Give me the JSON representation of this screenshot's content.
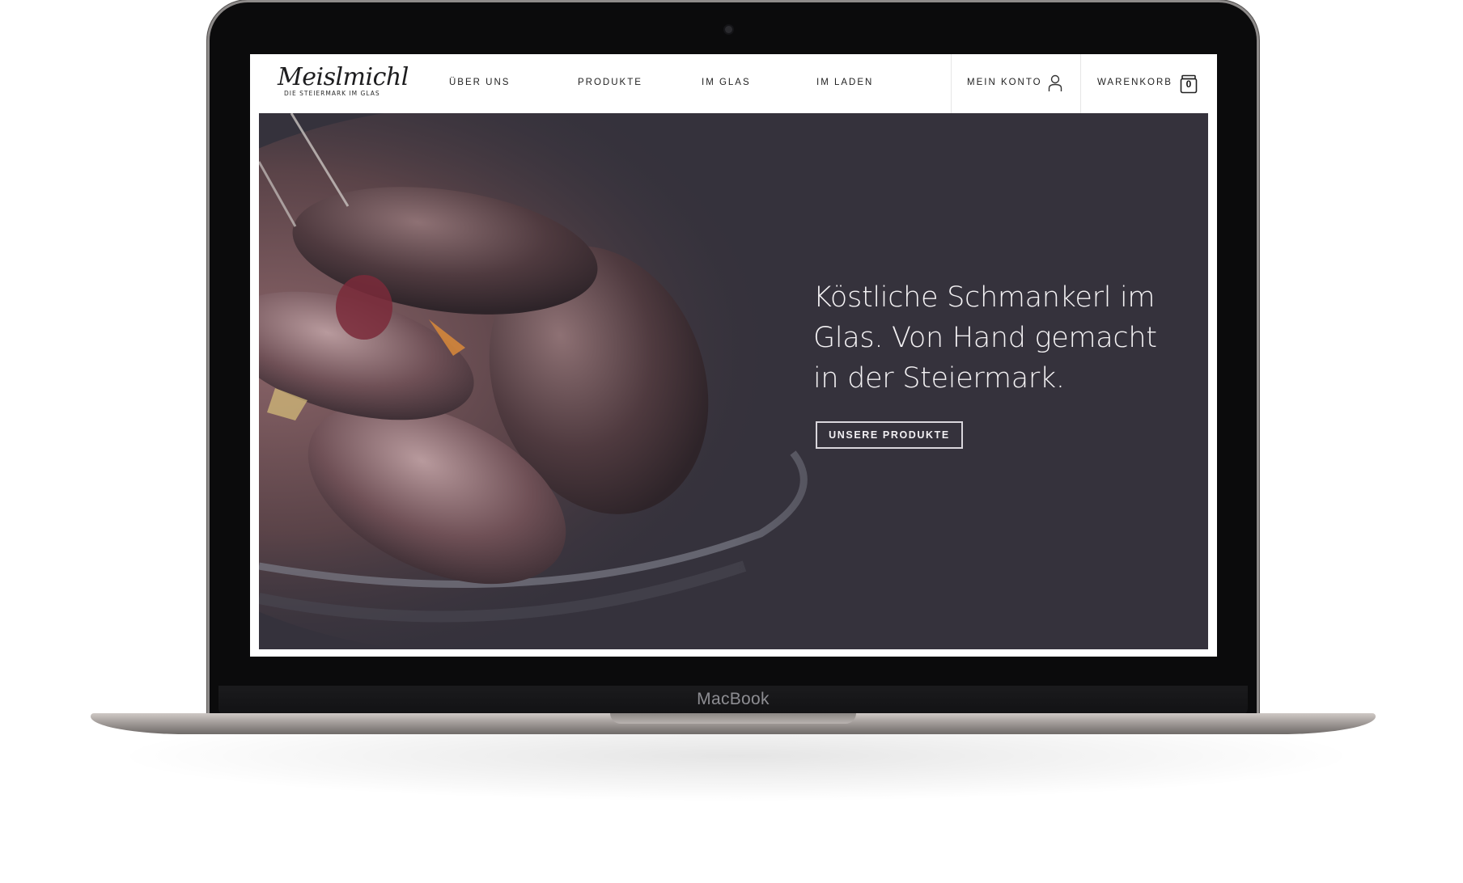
{
  "device": {
    "label": "MacBook"
  },
  "header": {
    "logo_text": "Meislmichl",
    "logo_subtitle": "DIE STEIERMARK IM GLAS",
    "nav": [
      {
        "label": "ÜBER UNS"
      },
      {
        "label": "PRODUKTE"
      },
      {
        "label": "IM GLAS"
      },
      {
        "label": "IM LADEN"
      }
    ],
    "account_label": "MEIN KONTO",
    "cart_label": "WARENKORB",
    "cart_count": "0"
  },
  "hero": {
    "title": "Köstliche Schmankerl im Glas. Von Hand gemacht in der Steiermark.",
    "button_label": "UNSERE PRODUKTE"
  },
  "colors": {
    "hero_background": "#35323c",
    "nav_background": "#ffffff",
    "text_light": "#f4f2f4",
    "laptop_frame": "#0b0b0c"
  },
  "icons": {
    "account": "user-icon",
    "cart": "jar-cart-icon"
  }
}
